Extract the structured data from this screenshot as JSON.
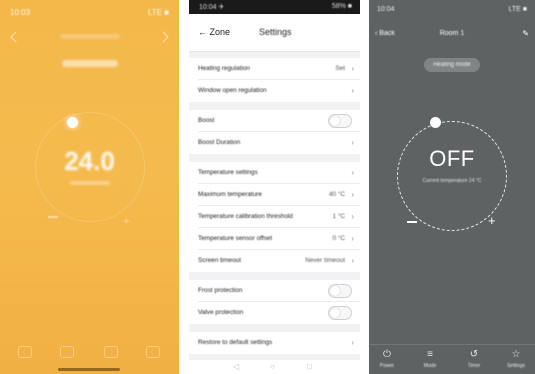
{
  "screen1": {
    "status_time": "10:03",
    "status_right": "LTE ■",
    "temperature": "24.0"
  },
  "screen2": {
    "status_time": "10:04 ✈",
    "status_right": "58% ■",
    "back_label": "Zone",
    "title": "Settings",
    "rows": [
      {
        "label": "Heating regulation",
        "value": "Set"
      },
      {
        "label": "Window open regulation",
        "value": ""
      },
      {
        "label": "Boost",
        "value": ""
      },
      {
        "label": "Boost Duration",
        "value": ""
      },
      {
        "label": "Temperature settings",
        "value": ""
      },
      {
        "label": "Maximum temperature",
        "value": "40 °C"
      },
      {
        "label": "Temperature calibration threshold",
        "value": "1 °C"
      },
      {
        "label": "Temperature sensor offset",
        "value": "0 °C"
      },
      {
        "label": "Screen timeout",
        "value": "Never timeout"
      },
      {
        "label": "Frost protection",
        "value": ""
      },
      {
        "label": "Valve protection",
        "value": ""
      },
      {
        "label": "Restore to default settings",
        "value": ""
      }
    ],
    "bottom_icons": [
      "◁",
      "○",
      "□"
    ]
  },
  "screen3": {
    "status_time": "10:04",
    "status_right": "LTE ■",
    "back_label": "‹ Back",
    "title": "Room 1",
    "mode_label": "Heating mode",
    "display_value": "OFF",
    "sub_label": "Current temperature 24 °C",
    "tabs": [
      {
        "glyph": "⏻",
        "label": "Power"
      },
      {
        "glyph": "≡",
        "label": "Mode"
      },
      {
        "glyph": "↺",
        "label": "Timer"
      },
      {
        "glyph": "☆",
        "label": "Settings"
      }
    ]
  }
}
